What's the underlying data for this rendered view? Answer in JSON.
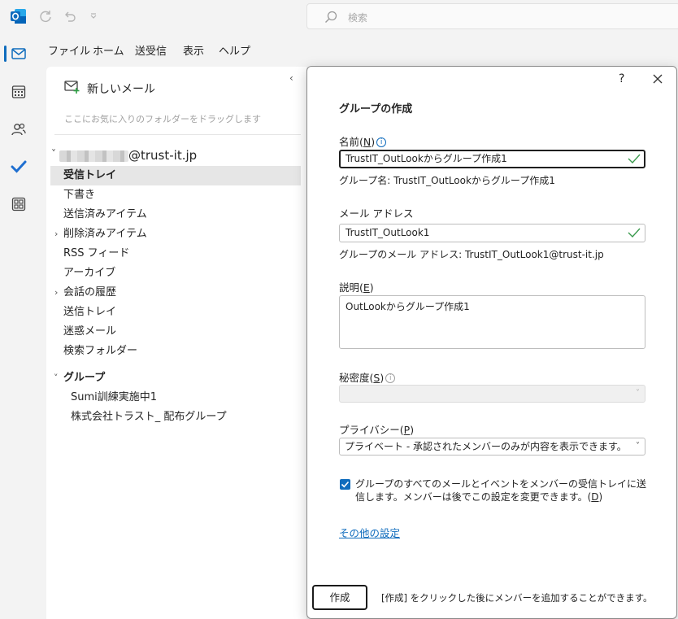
{
  "topbar": {
    "search_placeholder": "検索"
  },
  "menu": {
    "items": [
      "ファイル",
      "ホーム",
      "送受信",
      "表示",
      "ヘルプ"
    ]
  },
  "rail": {
    "items": [
      "mail-icon",
      "calendar-icon",
      "people-icon",
      "todo-icon",
      "apps-icon"
    ]
  },
  "folder_pane": {
    "new_mail_label": "新しいメール",
    "favorites_hint": "ここにお気に入りのフォルダーをドラッグします",
    "account_domain": "@trust-it.jp",
    "folders": [
      "受信トレイ",
      "下書き",
      "送信済みアイテム",
      "削除済みアイテム",
      "RSS フィード",
      "アーカイブ",
      "会話の履歴",
      "送信トレイ",
      "迷惑メール",
      "検索フォルダー"
    ],
    "groups_header": "グループ",
    "groups": [
      "Sumi訓練実施中1",
      "株式会社トラスト_ 配布グループ"
    ]
  },
  "dialog": {
    "help": "?",
    "title": "グループの作成",
    "name_label": "名前(",
    "name_key": "N",
    "name_label_end": ")",
    "name_value": "TrustIT_OutLookからグループ作成1",
    "group_name_hint": "グループ名: TrustIT_OutLookからグループ作成1",
    "email_label": "メール アドレス",
    "email_value": "TrustIT_OutLook1",
    "email_hint": "グループのメール アドレス: TrustIT_OutLook1@trust-it.jp",
    "desc_label": "説明(",
    "desc_key": "E",
    "desc_label_end": ")",
    "desc_value": "OutLookからグループ作成1",
    "sensitivity_label": "秘密度(",
    "sensitivity_key": "S",
    "sensitivity_label_end": ")",
    "sensitivity_value": "",
    "privacy_label": "プライバシー(",
    "privacy_key": "P",
    "privacy_label_end": ")",
    "privacy_value": "プライベート - 承認されたメンバーのみが内容を表示できます。",
    "checkbox_checked": true,
    "checkbox_text": "グループのすべてのメールとイベントをメンバーの受信トレイに送信します。メンバーは後でこの設定を変更できます。(",
    "checkbox_key": "D",
    "checkbox_text_end": ")",
    "more_settings_link": "その他の設定",
    "create_button": "作成",
    "footer_note": "[作成] をクリックした後にメンバーを追加することができます。"
  },
  "colors": {
    "accent": "#0f6cbd",
    "check_green": "#3a9a4e",
    "outlook_blue": "#0f6cbd"
  }
}
